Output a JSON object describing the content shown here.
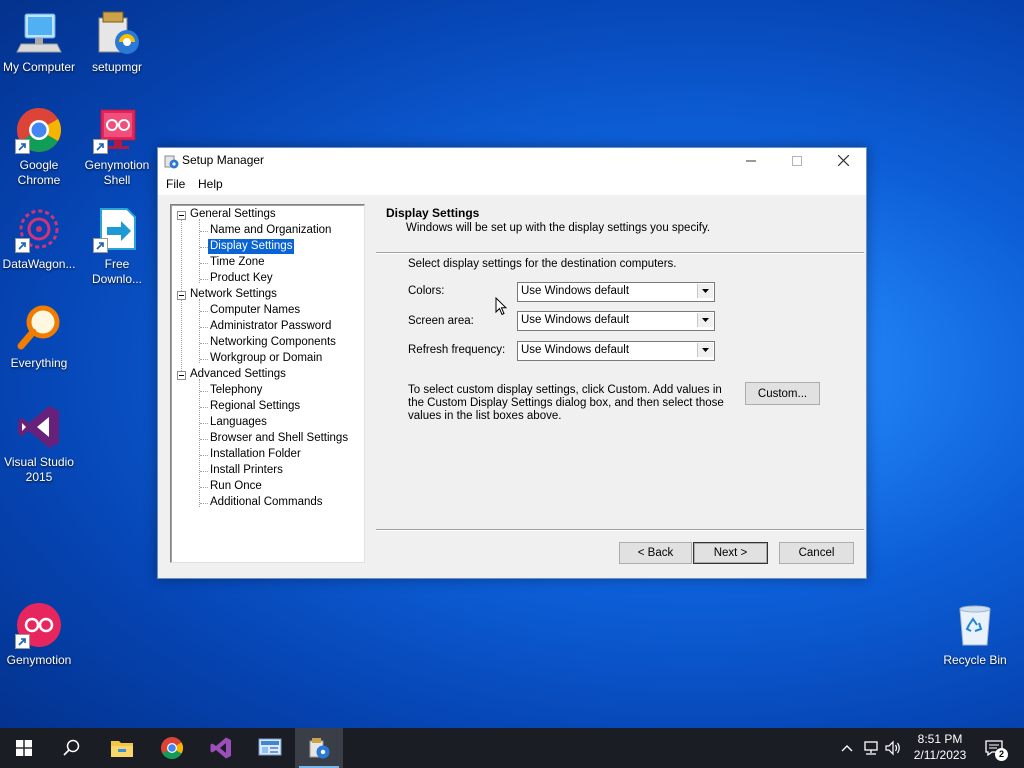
{
  "desktop": {
    "icons": [
      {
        "label": "My Computer"
      },
      {
        "label": "setupmgr"
      },
      {
        "label": "Google Chrome"
      },
      {
        "label": "Genymotion Shell"
      },
      {
        "label": "DataWagon..."
      },
      {
        "label": "Free Downlo..."
      },
      {
        "label": "Everything"
      },
      {
        "label": "Visual Studio 2015"
      },
      {
        "label": "Genymotion"
      },
      {
        "label": "Recycle Bin"
      }
    ]
  },
  "window": {
    "title": "Setup Manager",
    "menu": [
      "File",
      "Help"
    ],
    "tree": {
      "groups": [
        {
          "label": "General Settings",
          "items": [
            "Name and Organization",
            "Display Settings",
            "Time Zone",
            "Product Key"
          ]
        },
        {
          "label": "Network Settings",
          "items": [
            "Computer Names",
            "Administrator Password",
            "Networking Components",
            "Workgroup or Domain"
          ]
        },
        {
          "label": "Advanced Settings",
          "items": [
            "Telephony",
            "Regional Settings",
            "Languages",
            "Browser and Shell Settings",
            "Installation Folder",
            "Install Printers",
            "Run Once",
            "Additional Commands"
          ]
        }
      ],
      "selected": "Display Settings"
    },
    "page": {
      "title": "Display Settings",
      "subtitle": "Windows will be set up with the display settings you specify.",
      "instruction": "Select display settings for the destination computers.",
      "fields": [
        {
          "label": "Colors:",
          "value": "Use Windows default"
        },
        {
          "label": "Screen area:",
          "value": "Use Windows default"
        },
        {
          "label": "Refresh frequency:",
          "value": "Use Windows default"
        }
      ],
      "info_text": "To select custom display settings, click Custom. Add values in the Custom Display Settings dialog box, and then select those values in the list boxes above.",
      "custom_button": "Custom..."
    },
    "buttons": {
      "back": "< Back",
      "next": "Next >",
      "cancel": "Cancel"
    }
  },
  "taskbar": {
    "time": "8:51 PM",
    "date": "2/11/2023",
    "notification_count": "2"
  },
  "colors": {
    "selection": "#0a64d4",
    "taskbar": "#1a1d24",
    "accent": "#76b9ed"
  }
}
